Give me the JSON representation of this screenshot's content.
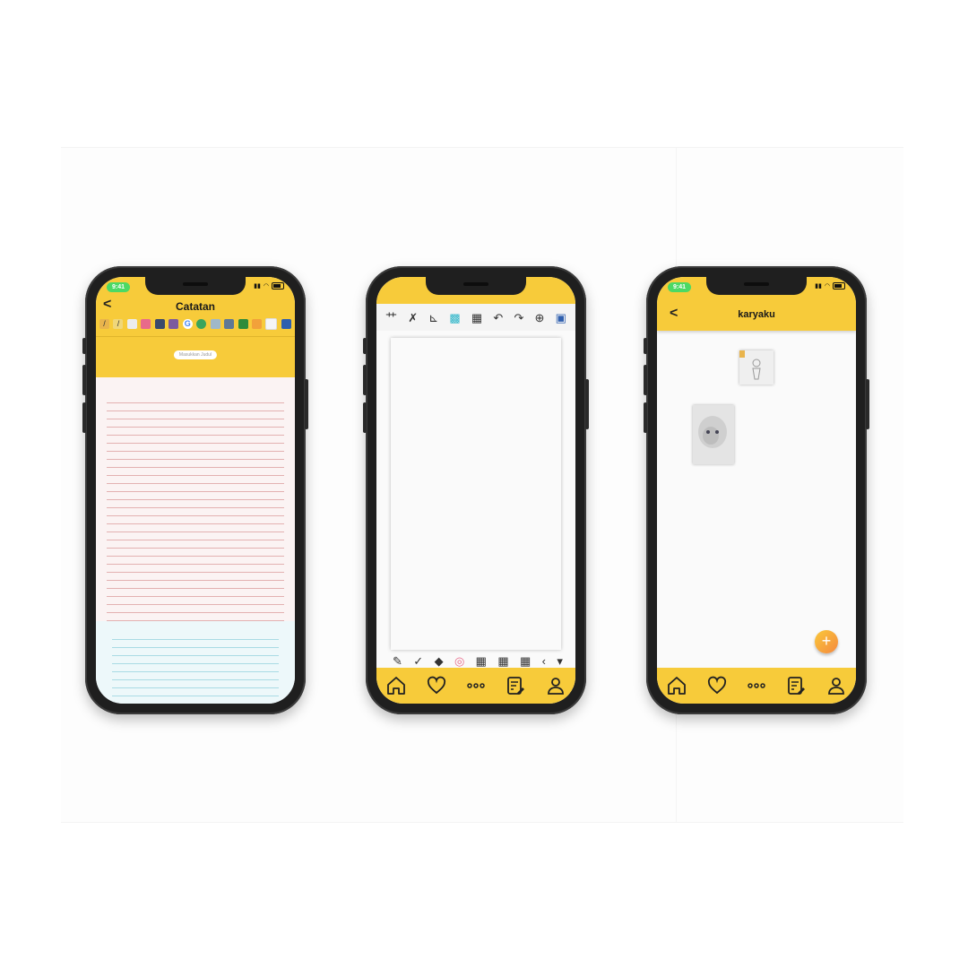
{
  "phones": {
    "notes": {
      "status_time": "9:41",
      "title": "Catatan",
      "back_label": "<",
      "chip_label": "Masukkan Judul",
      "toolbar_icons": [
        "pen-icon",
        "pencil-icon",
        "eraser-icon",
        "book-icon",
        "book-icon",
        "notebook-icon",
        "google-icon",
        "globe-icon",
        "gallery-icon",
        "gallery-icon",
        "app-icon",
        "document-icon",
        "document-icon",
        "save-icon"
      ]
    },
    "drawing": {
      "top_tools": [
        "brush-icon",
        "brush-icon",
        "ruler-icon",
        "color-icon",
        "pattern-icon",
        "undo-icon",
        "redo-icon",
        "add-icon",
        "save-icon"
      ],
      "top_glyphs": [
        "⺾",
        "✗",
        "⊾",
        "▩",
        "▦",
        "↶",
        "↷",
        "⊕",
        "▣"
      ],
      "bottom_tools": [
        "pen-icon",
        "check-icon",
        "eraser-icon",
        "color-wheel-icon",
        "pattern-icon",
        "pattern-icon",
        "pattern-icon",
        "chevron-left-icon",
        "dropdown-icon"
      ],
      "bottom_glyphs": [
        "✎",
        "✓",
        "◆",
        "◎",
        "▦",
        "▦",
        "▦",
        "‹",
        "▾"
      ]
    },
    "gallery": {
      "status_time": "9:41",
      "title": "karyaku",
      "back_label": "<",
      "fab_label": "+"
    }
  },
  "nav": [
    "home-icon",
    "heart-icon",
    "more-icon",
    "notes-icon",
    "profile-icon"
  ],
  "colors": {
    "accent": "#f7cb3a",
    "fab": "#f5893f"
  }
}
